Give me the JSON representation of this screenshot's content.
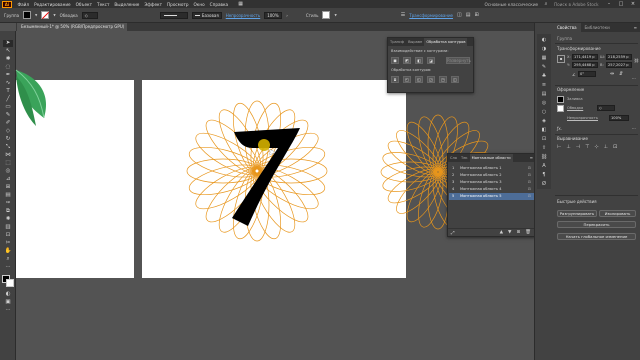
{
  "menu": {
    "logo": "Ai",
    "items": [
      "Файл",
      "Редактирование",
      "Объект",
      "Текст",
      "Выделение",
      "Эффект",
      "Просмотр",
      "Окно",
      "Справка"
    ],
    "workspace": "Основные классические",
    "search_placeholder": "Поиск в Adobe Stock"
  },
  "control_bar": {
    "selection_label": "Группа",
    "stroke_label": "Обводка",
    "stroke_style": "Базовая",
    "opacity_label": "Непрозрачность",
    "opacity_value": "100%",
    "styles_label": "Стиль",
    "transform_label": "Трансформирование"
  },
  "document": {
    "tab_title": "Безымянный-1* @ 50% (RGB/Предпросмотр GPU)",
    "close": "×"
  },
  "pathfinder": {
    "tabs": [
      "Трансф",
      "Выравн",
      "Обработка контуров"
    ],
    "shape_modes_label": "Взаимодействие с контурами:",
    "expand_label": "Развернуть",
    "pathfinders_label": "Обработка контуров:"
  },
  "artboards_panel": {
    "tabs": [
      "Сло",
      "Тек",
      "Монтажные области"
    ],
    "rows": [
      {
        "num": "1",
        "name": "Монтажная область 1"
      },
      {
        "num": "2",
        "name": "Монтажная область 2"
      },
      {
        "num": "3",
        "name": "Монтажная область 3"
      },
      {
        "num": "4",
        "name": "Монтажная область 4"
      },
      {
        "num": "5",
        "name": "Монтажная область 5"
      }
    ],
    "selected_index": 4
  },
  "properties": {
    "tabs": [
      "Свойства",
      "Библиотеки"
    ],
    "selection": "Группа",
    "transform_title": "Трансформирование",
    "x_label": "X:",
    "x_value": "171,4419 p",
    "w_label": "Ш:",
    "w_value": "218,2559 p",
    "y_label": "Y:",
    "y_value": "295,4468 p",
    "h_label": "В:",
    "h_value": "257,2027 p",
    "angle_value": "0°",
    "appearance_title": "Оформление",
    "fill_label": "Заливка",
    "stroke_label": "Обводка",
    "opacity_label": "Непрозрачность",
    "opacity_value": "100%",
    "align_title": "Выравнивание",
    "quick_actions_title": "Быстрые действия",
    "btn_ungroup": "Разгруппировать",
    "btn_isolate": "Изолировать",
    "btn_recolor": "Перекрасить",
    "btn_global_edit": "Начать глобальное изменение"
  },
  "colors": {
    "accent": "#ff9a00",
    "rosette": "#e8961c",
    "glyph": "#000000",
    "selection": "#4d6d98",
    "leaf": "#3aa35a"
  },
  "art": {
    "glyph": "7"
  }
}
